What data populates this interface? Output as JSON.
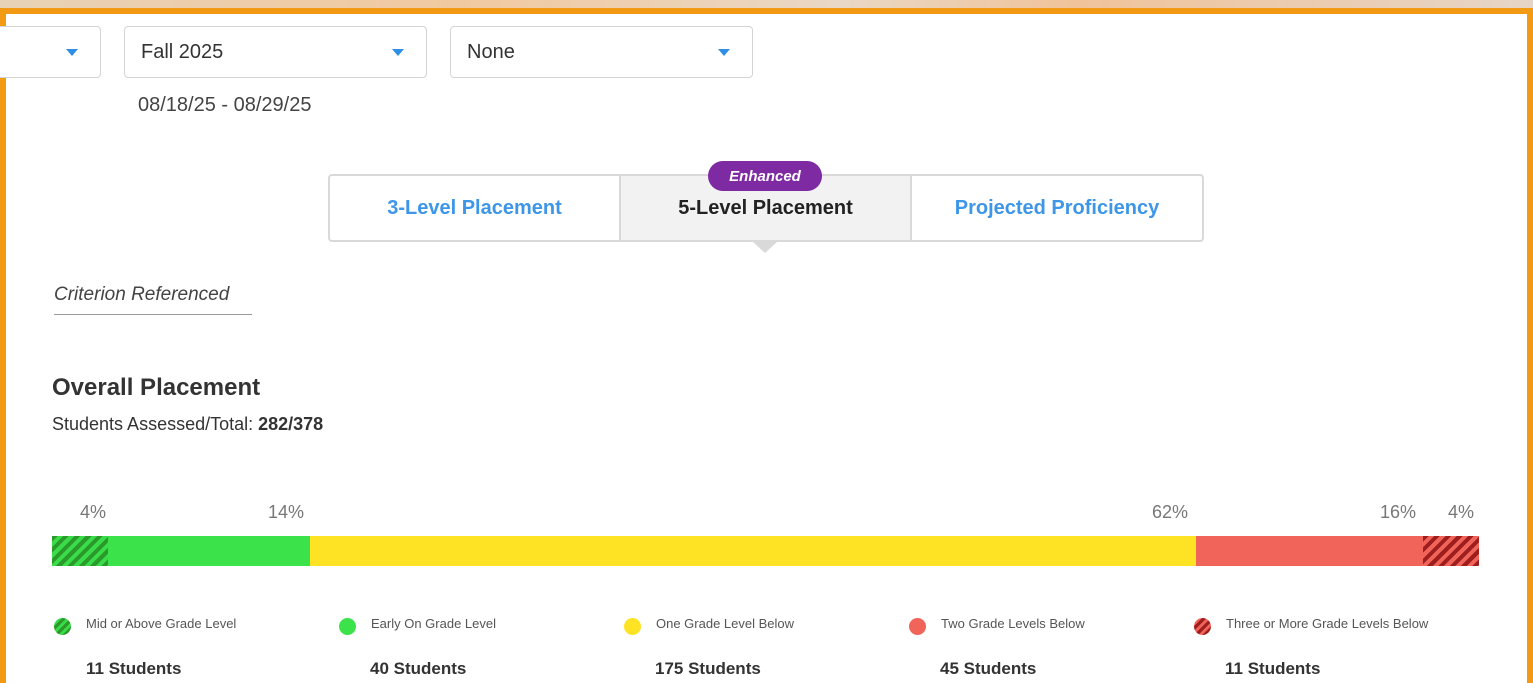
{
  "filters": {
    "first_select": "",
    "term_select": "Fall 2025",
    "group_select": "None",
    "date_range": "08/18/25 - 08/29/25"
  },
  "tabs": [
    {
      "label": "3-Level Placement"
    },
    {
      "label": "5-Level Placement"
    },
    {
      "label": "Projected Proficiency"
    }
  ],
  "badge": "Enhanced",
  "criterion_link": "Criterion Referenced",
  "overall": {
    "title": "Overall Placement",
    "assessed_label": "Students Assessed/Total: ",
    "assessed_value": "282/378"
  },
  "colors": {
    "frame": "#f29a14",
    "mid_or_above": "#2a9a2a",
    "early_on": "#3be24a",
    "one_below": "#fde324",
    "two_below": "#f0645a",
    "three_or_more_below": "#9e1e1e",
    "tab_link": "#3d96e8",
    "badge": "#7d2aa3"
  },
  "chart_data": {
    "type": "bar",
    "orientation": "horizontal-stacked",
    "categories": [
      "Mid or Above Grade Level",
      "Early On Grade Level",
      "One Grade Level Below",
      "Two Grade Levels Below",
      "Three or More Grade Levels Below"
    ],
    "percent_labels": [
      "4%",
      "14%",
      "62%",
      "16%",
      "4%"
    ],
    "student_counts": [
      "11 Students",
      "40 Students",
      "175 Students",
      "45 Students",
      "11 Students"
    ],
    "values": [
      11,
      40,
      175,
      45,
      11
    ],
    "legend_position": "bottom"
  }
}
